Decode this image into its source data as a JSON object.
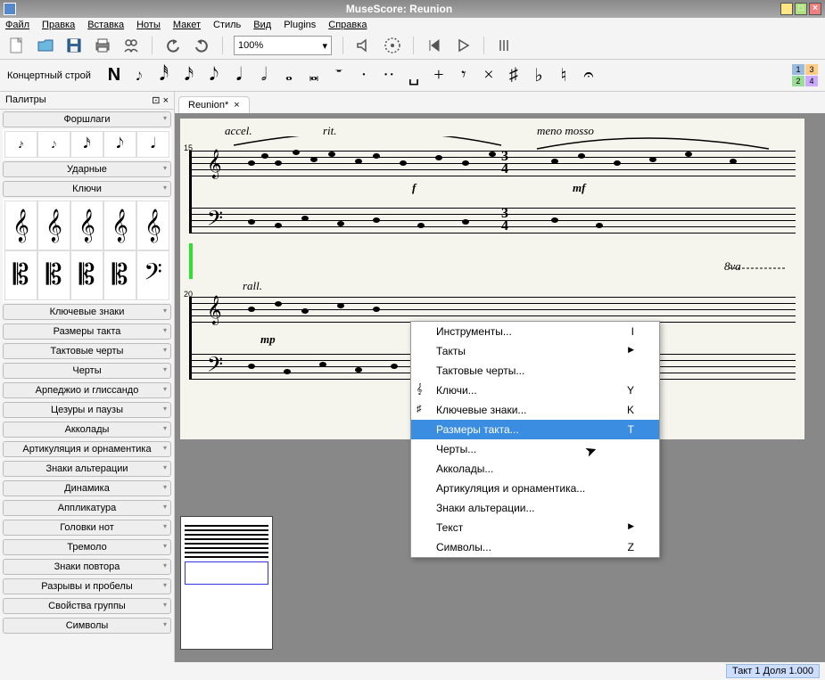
{
  "window": {
    "title": "MuseScore: Reunion"
  },
  "menu": [
    "Файл",
    "Правка",
    "Вставка",
    "Ноты",
    "Макет",
    "Стиль",
    "Вид",
    "Plugins",
    "Справка"
  ],
  "toolbar": {
    "zoom": "100%"
  },
  "notebar": {
    "label": "Концертный строй",
    "glyphs": [
      "N",
      "𝆕",
      "𝅘𝅥𝅰",
      "𝅘𝅥𝅯",
      "𝅘𝅥𝅮",
      "𝅘𝅥",
      "𝅗𝅥",
      "𝅝",
      "𝅜",
      "𝄻",
      "·",
      "··",
      "␣",
      "+",
      "𝄾",
      "×",
      "♯",
      "♭",
      "♮",
      "𝄐"
    ]
  },
  "voices": [
    "1",
    "2",
    "3",
    "4"
  ],
  "palette": {
    "title": "Палитры",
    "grace": "Форшлаги",
    "grace_cells": [
      "𝆔",
      "𝆕",
      "𝅘𝅥𝅯",
      "𝅘𝅥𝅮",
      "𝅘𝅥"
    ],
    "drums": "Ударные",
    "clefs": "Ключи",
    "clef_cells": [
      "𝄞",
      "𝄞",
      "𝄞",
      "𝄞",
      "𝄞",
      "𝄡",
      "𝄡",
      "𝄡",
      "𝄡",
      "𝄢"
    ],
    "sections": [
      "Ключевые знаки",
      "Размеры такта",
      "Тактовые черты",
      "Черты",
      "Арпеджио и глиссандо",
      "Цезуры и паузы",
      "Акколады",
      "Артикуляция и орнаментика",
      "Знаки альтерации",
      "Динамика",
      "Аппликатура",
      "Головки нот",
      "Тремоло",
      "Знаки повтора",
      "Разрывы и пробелы",
      "Свойства группы",
      "Символы"
    ]
  },
  "tab": {
    "label": "Reunion*"
  },
  "tempo_marks": {
    "accel": "accel.",
    "rit": "rit.",
    "meno": "meno mosso",
    "rall": "rall.",
    "f": "f",
    "mf": "mf",
    "mp": "mp",
    "ottava": "8va"
  },
  "bar_numbers": {
    "fifteen": "15",
    "twenty": "20"
  },
  "time_sig": {
    "num": "3",
    "den": "4"
  },
  "context_menu": [
    {
      "label": "Инструменты...",
      "shortcut": "I",
      "arrow": false
    },
    {
      "label": "Такты",
      "shortcut": "",
      "arrow": true
    },
    {
      "label": "Тактовые черты...",
      "shortcut": "",
      "arrow": false
    },
    {
      "label": "Ключи...",
      "shortcut": "Y",
      "arrow": false,
      "icon": "𝄞"
    },
    {
      "label": "Ключевые знаки...",
      "shortcut": "K",
      "arrow": false,
      "icon": "♯"
    },
    {
      "label": "Размеры такта...",
      "shortcut": "T",
      "arrow": false,
      "hl": true
    },
    {
      "label": "Черты...",
      "shortcut": "",
      "arrow": false
    },
    {
      "label": "Акколады...",
      "shortcut": "",
      "arrow": false
    },
    {
      "label": "Артикуляция и орнаментика...",
      "shortcut": "",
      "arrow": false
    },
    {
      "label": "Знаки альтерации...",
      "shortcut": "",
      "arrow": false
    },
    {
      "label": "Текст",
      "shortcut": "",
      "arrow": true
    },
    {
      "label": "Символы...",
      "shortcut": "Z",
      "arrow": false
    }
  ],
  "status": {
    "text": "Такт 1 Доля 1.000"
  }
}
